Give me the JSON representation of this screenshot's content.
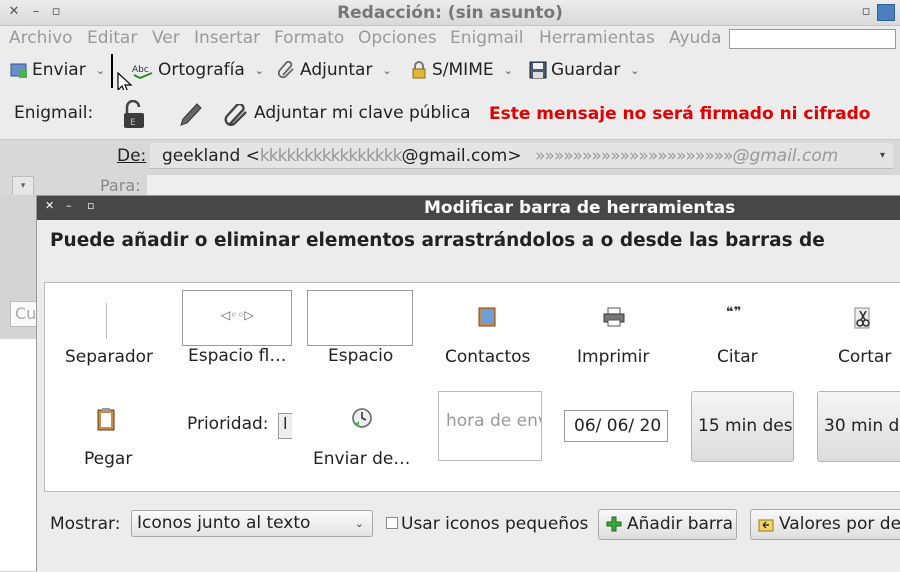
{
  "window": {
    "title": "Redacción: (sin asunto)"
  },
  "menubar": {
    "items": [
      "Archivo",
      "Editar",
      "Ver",
      "Insertar",
      "Formato",
      "Opciones",
      "Enigmail",
      "Herramientas",
      "Ayuda"
    ]
  },
  "toolbar": {
    "send_label": "Enviar",
    "spelling_label": "Ortografía",
    "attach_label": "Adjuntar",
    "smime_label": "S/MIME",
    "save_label": "Guardar"
  },
  "enigmail": {
    "label": "Enigmail:",
    "attach_key_label": "Adjuntar mi clave pública",
    "status": "Este mensaje no será firmado ni cifrado",
    "status_color": "#e00000"
  },
  "headers": {
    "from_label": "De:",
    "from_name": "geekland <",
    "from_blurred_user": "kkkkkkkkkkkkkkkk",
    "from_domain": "@gmail.com>",
    "from_blurred_alias": "»»»»»»»»»»»»»»»»»»»»»",
    "from_alias_domain": "@gmail.com",
    "to_label": "Para:",
    "left_partial_input": "Cu"
  },
  "dialog": {
    "title": "Modificar barra de herramientas",
    "heading": "Puede añadir o eliminar elementos arrastrándolos a o desde las barras de",
    "palette": {
      "separator": "Separador",
      "flexspace": "Espacio fl…",
      "space": "Espacio",
      "contacts": "Contactos",
      "print": "Imprimir",
      "quote": "Citar",
      "cut": "Cortar",
      "paste": "Pegar",
      "priority": "Prioridad:",
      "send_later": "Enviar de…",
      "send_time_placeholder": "hora de env",
      "date_value": "06/ 06/  20",
      "fifteen_min": "15 min des",
      "thirty_min": "30 min d"
    },
    "show_label": "Mostrar:",
    "show_select_value": "Iconos junto al texto",
    "small_icons_label": "Usar iconos pequeños",
    "small_icons_checked": false,
    "add_bar_label": "Añadir barra",
    "defaults_label": "Valores por def"
  }
}
